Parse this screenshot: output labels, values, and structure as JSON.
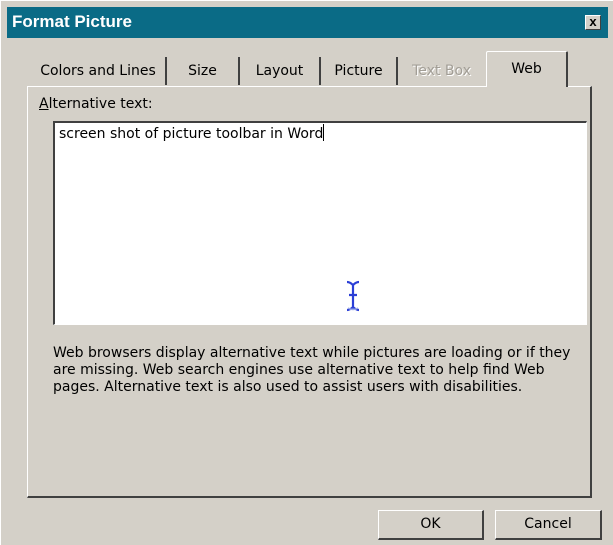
{
  "window": {
    "title": "Format Picture",
    "close_glyph": "x"
  },
  "tabs": [
    {
      "label": "Colors and Lines",
      "state": "normal"
    },
    {
      "label": "Size",
      "state": "normal"
    },
    {
      "label": "Layout",
      "state": "normal"
    },
    {
      "label": "Picture",
      "state": "normal"
    },
    {
      "label": "Text Box",
      "state": "disabled"
    },
    {
      "label": "Web",
      "state": "selected"
    }
  ],
  "web_tab": {
    "alt_text_label_mnemonic": "A",
    "alt_text_label_rest": "lternative text:",
    "alt_text_value": "screen shot of picture toolbar in Word",
    "help_text": "Web browsers display alternative text while pictures are loading or if they are missing.  Web search engines use alternative text to help find Web pages.  Alternative text is also used to assist users with disabilities."
  },
  "buttons": {
    "ok_label": "OK",
    "cancel_label": "Cancel"
  },
  "colors": {
    "title_bar": "#0a6b86",
    "dialog_face": "#d4d0c8"
  },
  "icons": {
    "cursor": "text-ibeam-cursor-icon"
  }
}
